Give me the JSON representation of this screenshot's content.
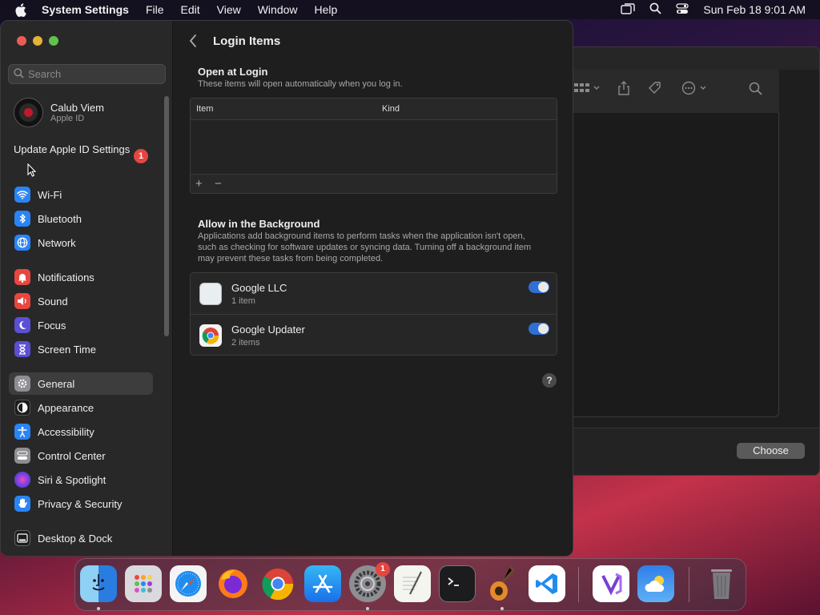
{
  "menubar": {
    "app_name": "System Settings",
    "items": [
      "File",
      "Edit",
      "View",
      "Window",
      "Help"
    ],
    "clock": "Sun Feb 18  9:01 AM"
  },
  "sidebar": {
    "search_placeholder": "Search",
    "profile": {
      "name": "Calub Viem",
      "subtitle": "Apple ID"
    },
    "update_label": "Update Apple ID Settings",
    "update_badge": "1",
    "items": [
      {
        "label": "Wi-Fi",
        "icon": "wifi-icon",
        "color": "#2a84f5"
      },
      {
        "label": "Bluetooth",
        "icon": "bluetooth-icon",
        "color": "#2a84f5"
      },
      {
        "label": "Network",
        "icon": "globe-icon",
        "color": "#2a84f5"
      },
      {
        "label": "Notifications",
        "icon": "bell-icon",
        "color": "#e8473f"
      },
      {
        "label": "Sound",
        "icon": "speaker-icon",
        "color": "#e8473f"
      },
      {
        "label": "Focus",
        "icon": "moon-icon",
        "color": "#5b4fd6"
      },
      {
        "label": "Screen Time",
        "icon": "hourglass-icon",
        "color": "#5b4fd6"
      },
      {
        "label": "General",
        "icon": "gear-icon",
        "color": "#8e8e93"
      },
      {
        "label": "Appearance",
        "icon": "appearance-icon",
        "color": "#1c1c1e"
      },
      {
        "label": "Accessibility",
        "icon": "accessibility-icon",
        "color": "#2a84f5"
      },
      {
        "label": "Control Center",
        "icon": "control-center-icon",
        "color": "#8e8e93"
      },
      {
        "label": "Siri & Spotlight",
        "icon": "siri-icon",
        "color": "#9b3fd6"
      },
      {
        "label": "Privacy & Security",
        "icon": "hand-icon",
        "color": "#2a84f5"
      },
      {
        "label": "Desktop & Dock",
        "icon": "dock-icon",
        "color": "#1c1c1e"
      }
    ],
    "selected": "General"
  },
  "content": {
    "title": "Login Items",
    "open_at_login": {
      "title": "Open at Login",
      "desc": "These items will open automatically when you log in.",
      "col_item": "Item",
      "col_kind": "Kind",
      "add": "+",
      "remove": "−"
    },
    "background": {
      "title": "Allow in the Background",
      "desc": "Applications add background items to perform tasks when the application isn't open, such as checking for software updates or syncing data. Turning off a background item may prevent these tasks from being completed.",
      "items": [
        {
          "name": "Google LLC",
          "sub": "1 item",
          "enabled": true
        },
        {
          "name": "Google Updater",
          "sub": "2 items",
          "enabled": true
        }
      ]
    },
    "help": "?"
  },
  "background_window": {
    "choose_label": "Choose"
  },
  "dock": {
    "apps": [
      "Finder",
      "Launchpad",
      "Safari",
      "Firefox",
      "Chrome",
      "App Store",
      "System Settings",
      "TextEdit",
      "Terminal",
      "GarageBand",
      "VS Code",
      "Visual Studio",
      "Weather",
      "Trash"
    ],
    "settings_badge": "1"
  }
}
